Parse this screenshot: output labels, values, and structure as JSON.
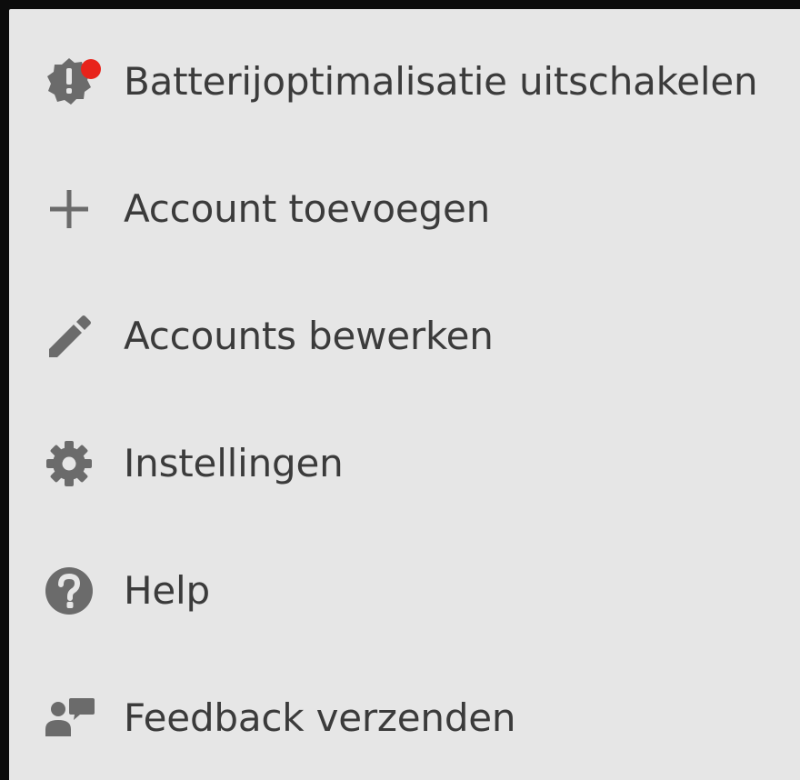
{
  "menu": {
    "items": [
      {
        "label": "Batterijoptimalisatie uitschakelen",
        "icon": "battery-alert-icon",
        "has_badge": true
      },
      {
        "label": "Account toevoegen",
        "icon": "plus-icon"
      },
      {
        "label": "Accounts bewerken",
        "icon": "pencil-icon"
      },
      {
        "label": "Instellingen",
        "icon": "gear-icon"
      },
      {
        "label": "Help",
        "icon": "help-circle-icon"
      },
      {
        "label": "Feedback verzenden",
        "icon": "feedback-icon"
      }
    ]
  },
  "colors": {
    "background": "#e6e6e6",
    "frame": "#0c0c0c",
    "text": "#3b3b3b",
    "icon": "#6b6b6b",
    "badge": "#e8231b"
  }
}
